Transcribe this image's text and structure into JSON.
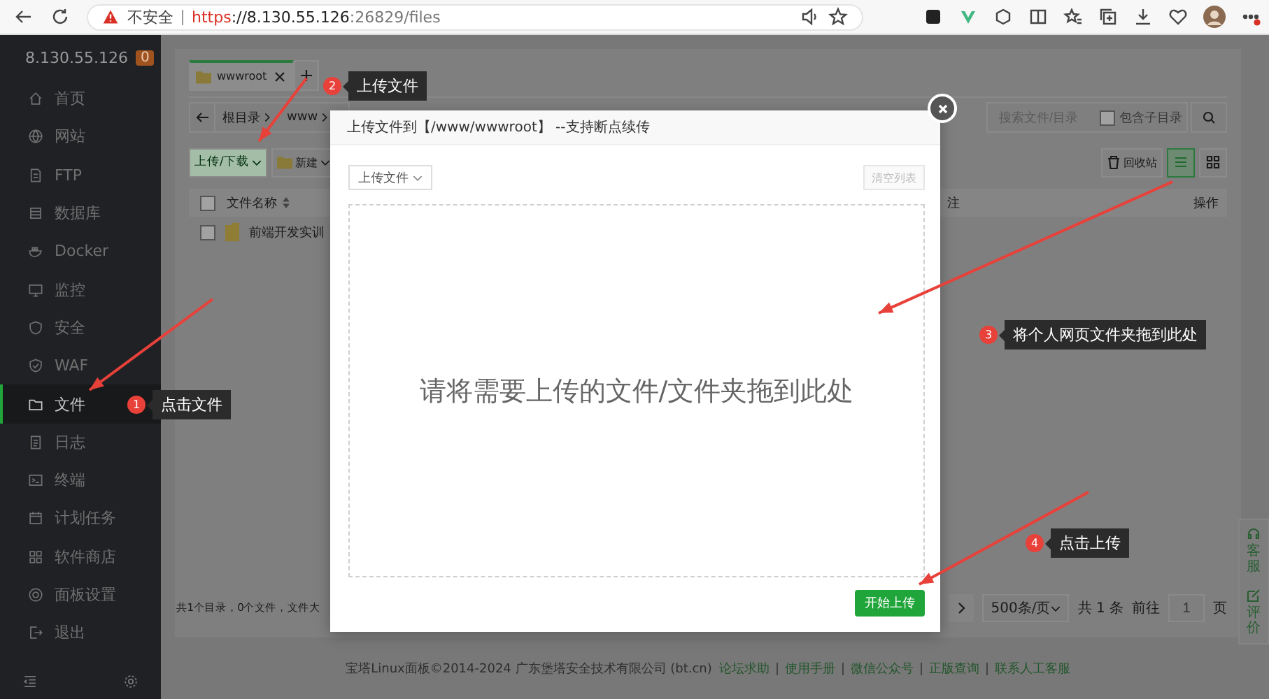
{
  "browser": {
    "security_label": "不安全",
    "url": [
      {
        "text": "https",
        "kind": "scheme"
      },
      {
        "text": "://8.130.55.126",
        "kind": "host"
      },
      {
        "text": ":26829/files",
        "kind": "path"
      }
    ]
  },
  "sidebar": {
    "server": "8.130.55.126",
    "badge": "0",
    "items": [
      {
        "label": "首页",
        "selected": false
      },
      {
        "label": "网站",
        "selected": false
      },
      {
        "label": "FTP",
        "selected": false
      },
      {
        "label": "数据库",
        "selected": false
      },
      {
        "label": "Docker",
        "selected": false
      },
      {
        "label": "监控",
        "selected": false
      },
      {
        "label": "安全",
        "selected": false
      },
      {
        "label": "WAF",
        "selected": false
      },
      {
        "label": "文件",
        "selected": true
      },
      {
        "label": "日志",
        "selected": false
      },
      {
        "label": "终端",
        "selected": false
      },
      {
        "label": "计划任务",
        "selected": false
      },
      {
        "label": "软件商店",
        "selected": false
      },
      {
        "label": "面板设置",
        "selected": false
      },
      {
        "label": "退出",
        "selected": false
      }
    ]
  },
  "file_tabs": [
    {
      "label": "wwwroot",
      "selected": true
    }
  ],
  "breadcrumb": [
    "根目录",
    "www"
  ],
  "search": {
    "placeholder": "搜索文件/目录",
    "include_subdirs": {
      "label": "包含子目录",
      "checked": false
    }
  },
  "toolbar": {
    "upload_download": "上传/下载",
    "new": "新建",
    "recycle_bin": "回收站",
    "views": [
      {
        "kind": "list",
        "selected": true
      },
      {
        "kind": "grid",
        "selected": false
      }
    ]
  },
  "table": {
    "header_checked": false,
    "columns": [
      {
        "label": "文件名称",
        "kind": "name"
      },
      {
        "label": "注",
        "kind": "note"
      },
      {
        "label": "操作",
        "kind": "actions"
      }
    ],
    "rows": [
      {
        "name": "前端开发实训",
        "checked": false
      }
    ]
  },
  "summary": "共1个目录，0个文件，文件大",
  "pagination": {
    "page_size": "500条/页",
    "total": "共 1 条",
    "goto": "前往",
    "page": "1",
    "page_suffix": "页"
  },
  "footer": {
    "copyright": "宝塔Linux面板©2014-2024 广东堡塔安全技术有限公司 (bt.cn)",
    "links": [
      "论坛求助",
      "使用手册",
      "微信公众号",
      "正版查询",
      "联系人工客服"
    ]
  },
  "float_buttons": [
    {
      "label": "客服"
    },
    {
      "label": "评价"
    }
  ],
  "modal": {
    "title": "上传文件到【/www/wwwroot】 --支持断点续传",
    "upload_type": "上传文件",
    "clear_button": {
      "label": "清空列表",
      "disabled": true
    },
    "dropzone": "请将需要上传的文件/文件夹拖到此处",
    "start_button": "开始上传"
  },
  "annotations": [
    {
      "number": "1",
      "label": "点击文件"
    },
    {
      "number": "2",
      "label": "上传文件"
    },
    {
      "number": "3",
      "label": "将个人网页文件夹拖到此处"
    },
    {
      "number": "4",
      "label": "点击上传"
    }
  ]
}
